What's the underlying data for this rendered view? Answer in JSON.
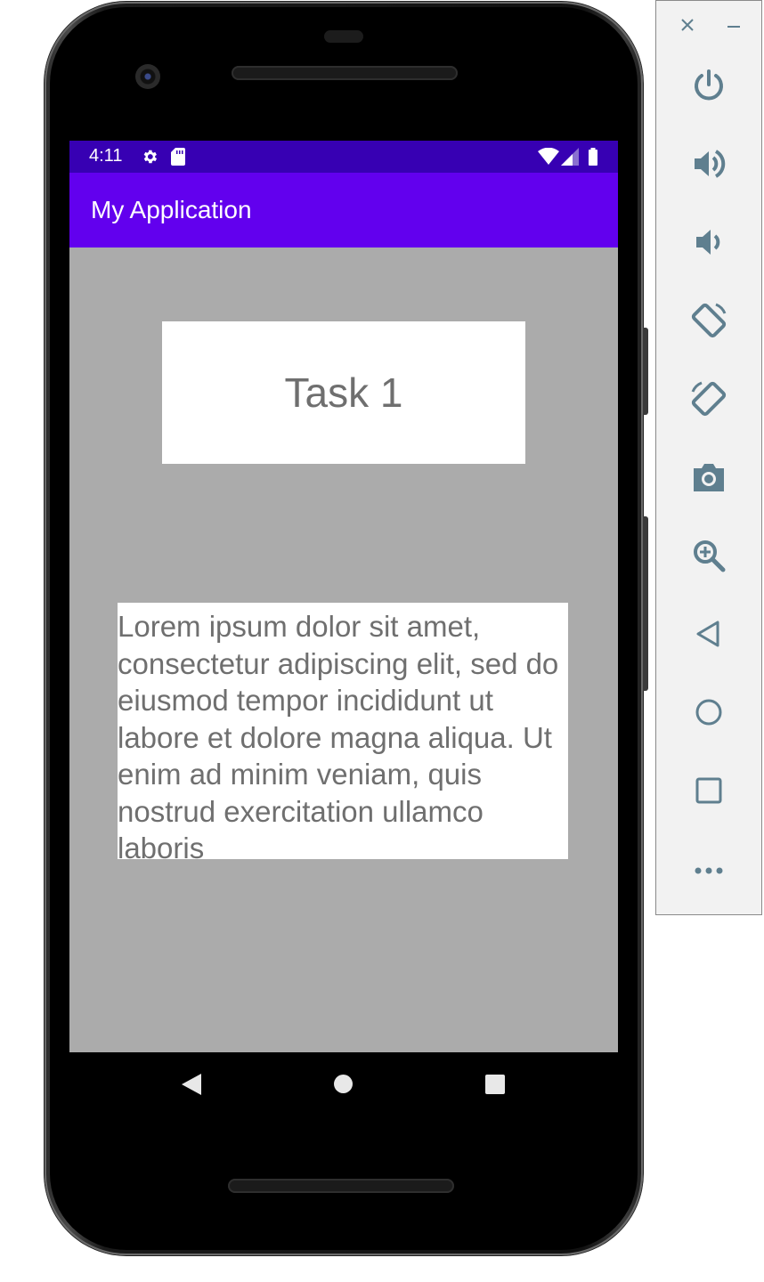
{
  "statusbar": {
    "time": "4:11",
    "icons": [
      "settings-icon",
      "sd-card-icon",
      "wifi-icon",
      "signal-icon",
      "battery-icon"
    ]
  },
  "appbar": {
    "title": "My Application"
  },
  "content": {
    "task_title": "Task 1",
    "body_text": "Lorem ipsum dolor sit amet, consectetur adipiscing elit, sed do eiusmod tempor incididunt ut labore et dolore magna aliqua. Ut enim ad minim veniam, quis nostrud exercitation ullamco laboris"
  },
  "navbar": {
    "buttons": [
      "back",
      "home",
      "recents"
    ]
  },
  "emulator_panel": {
    "window_controls": [
      "close",
      "minimize"
    ],
    "tools": [
      "power",
      "volume-up",
      "volume-down",
      "rotate-left",
      "rotate-right",
      "screenshot",
      "zoom",
      "back",
      "home",
      "overview",
      "more"
    ]
  },
  "colors": {
    "statusbar_bg": "#3700b3",
    "appbar_bg": "#6200ee",
    "screen_bg": "#ababab",
    "text_gray": "#6f6f6f",
    "panel_icon": "#5f7f8f"
  }
}
